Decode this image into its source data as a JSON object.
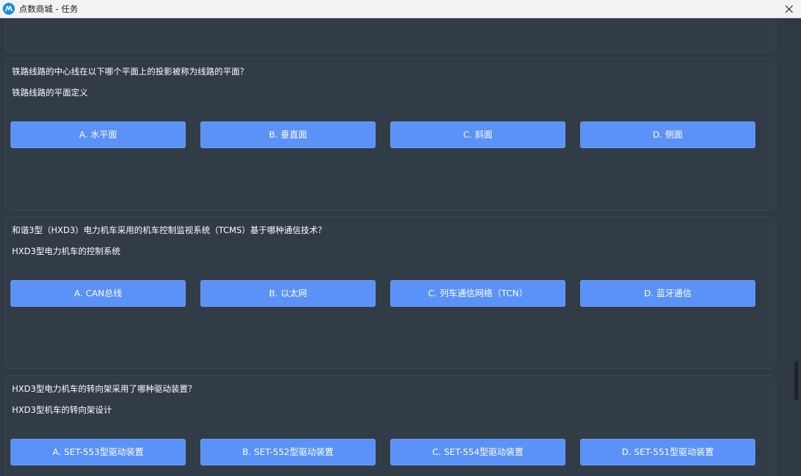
{
  "window": {
    "title": "点数商城 - 任务",
    "icon": "app-logo-icon",
    "close_icon": "close-icon"
  },
  "questions": [
    {
      "text": "铁路线路的中心线在以下哪个平面上的投影被称为线路的平面？",
      "hint": "铁路线路的平面定义",
      "options": [
        "A. 水平面",
        "B. 垂直面",
        "C. 斜面",
        "D. 侧面"
      ]
    },
    {
      "text": "和谐3型（HXD3）电力机车采用的机车控制监视系统（TCMS）基于哪种通信技术？",
      "hint": "HXD3型电力机车的控制系统",
      "options": [
        "A. CAN总线",
        "B. 以太网",
        "C. 列车通信网络（TCN）",
        "D. 蓝牙通信"
      ]
    },
    {
      "text": "HXD3型电力机车的转向架采用了哪种驱动装置？",
      "hint": "HXD3型机车的转向架设计",
      "options": [
        "A. SET-553型驱动装置",
        "B. SET-552型驱动装置",
        "C. SET-554型驱动装置",
        "D. SET-551型驱动装置"
      ]
    }
  ],
  "colors": {
    "background": "#2f3944",
    "card": "#323c47",
    "option_button": "#5b92f8",
    "titlebar": "#f3f3f3"
  }
}
